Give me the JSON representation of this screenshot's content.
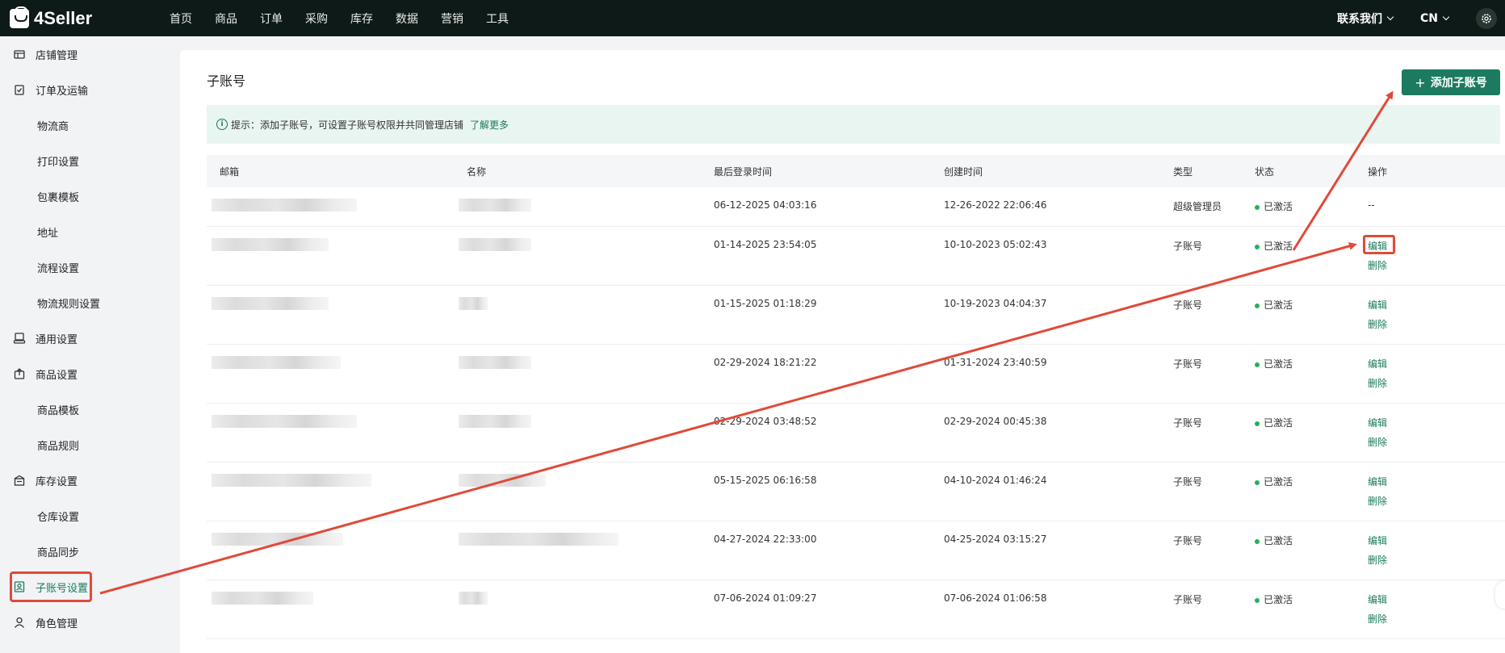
{
  "brand": {
    "name": "4Seller"
  },
  "nav": [
    "首页",
    "商品",
    "订单",
    "采购",
    "库存",
    "数据",
    "营销",
    "工具"
  ],
  "top_right": {
    "contact": "联系我们",
    "lang": "CN"
  },
  "sidebar": [
    {
      "label": "店铺管理",
      "level": "top",
      "icon": "store-icon"
    },
    {
      "label": "订单及运输",
      "level": "top",
      "icon": "order-icon"
    },
    {
      "label": "物流商",
      "level": "sub"
    },
    {
      "label": "打印设置",
      "level": "sub"
    },
    {
      "label": "包裹模板",
      "level": "sub"
    },
    {
      "label": "地址",
      "level": "sub"
    },
    {
      "label": "流程设置",
      "level": "sub"
    },
    {
      "label": "物流规则设置",
      "level": "sub"
    },
    {
      "label": "通用设置",
      "level": "top",
      "icon": "settings-icon"
    },
    {
      "label": "商品设置",
      "level": "top",
      "icon": "product-icon"
    },
    {
      "label": "商品模板",
      "level": "sub"
    },
    {
      "label": "商品规则",
      "level": "sub"
    },
    {
      "label": "库存设置",
      "level": "top",
      "icon": "inventory-icon"
    },
    {
      "label": "仓库设置",
      "level": "sub"
    },
    {
      "label": "商品同步",
      "level": "sub"
    },
    {
      "label": "子账号设置",
      "level": "top",
      "icon": "sub-account-icon",
      "active": true
    },
    {
      "label": "角色管理",
      "level": "top",
      "icon": "role-icon"
    }
  ],
  "page": {
    "title": "子账号",
    "add_button": "添加子账号",
    "tip_text": "提示：添加子账号，可设置子账号权限并共同管理店铺",
    "tip_link": "了解更多"
  },
  "table": {
    "headers": {
      "email": "邮箱",
      "name": "名称",
      "last_login": "最后登录时间",
      "created": "创建时间",
      "type": "类型",
      "status": "状态",
      "ops": "操作"
    },
    "rows": [
      {
        "last_login": "06-12-2025 04:03:16",
        "created": "12-26-2022 22:06:46",
        "type": "超级管理员",
        "status": "已激活",
        "ops": [
          "--"
        ]
      },
      {
        "last_login": "01-14-2025 23:54:05",
        "created": "10-10-2023 05:02:43",
        "type": "子账号",
        "status": "已激活",
        "ops": [
          "编辑",
          "删除"
        ]
      },
      {
        "last_login": "01-15-2025 01:18:29",
        "created": "10-19-2023 04:04:37",
        "type": "子账号",
        "status": "已激活",
        "ops": [
          "编辑",
          "删除"
        ]
      },
      {
        "last_login": "02-29-2024 18:21:22",
        "created": "01-31-2024 23:40:59",
        "type": "子账号",
        "status": "已激活",
        "ops": [
          "编辑",
          "删除"
        ]
      },
      {
        "last_login": "02-29-2024 03:48:52",
        "created": "02-29-2024 00:45:38",
        "type": "子账号",
        "status": "已激活",
        "ops": [
          "编辑",
          "删除"
        ]
      },
      {
        "last_login": "05-15-2025 06:16:58",
        "created": "04-10-2024 01:46:24",
        "type": "子账号",
        "status": "已激活",
        "ops": [
          "编辑",
          "删除"
        ]
      },
      {
        "last_login": "04-27-2024 22:33:00",
        "created": "04-25-2024 03:15:27",
        "type": "子账号",
        "status": "已激活",
        "ops": [
          "编辑",
          "删除"
        ]
      },
      {
        "last_login": "07-06-2024 01:09:27",
        "created": "07-06-2024 01:06:58",
        "type": "子账号",
        "status": "已激活",
        "ops": [
          "编辑",
          "删除"
        ]
      }
    ]
  },
  "colors": {
    "brand_green": "#1b7a5f",
    "annotation_red": "#e04a3a",
    "status_green": "#23b35a"
  }
}
